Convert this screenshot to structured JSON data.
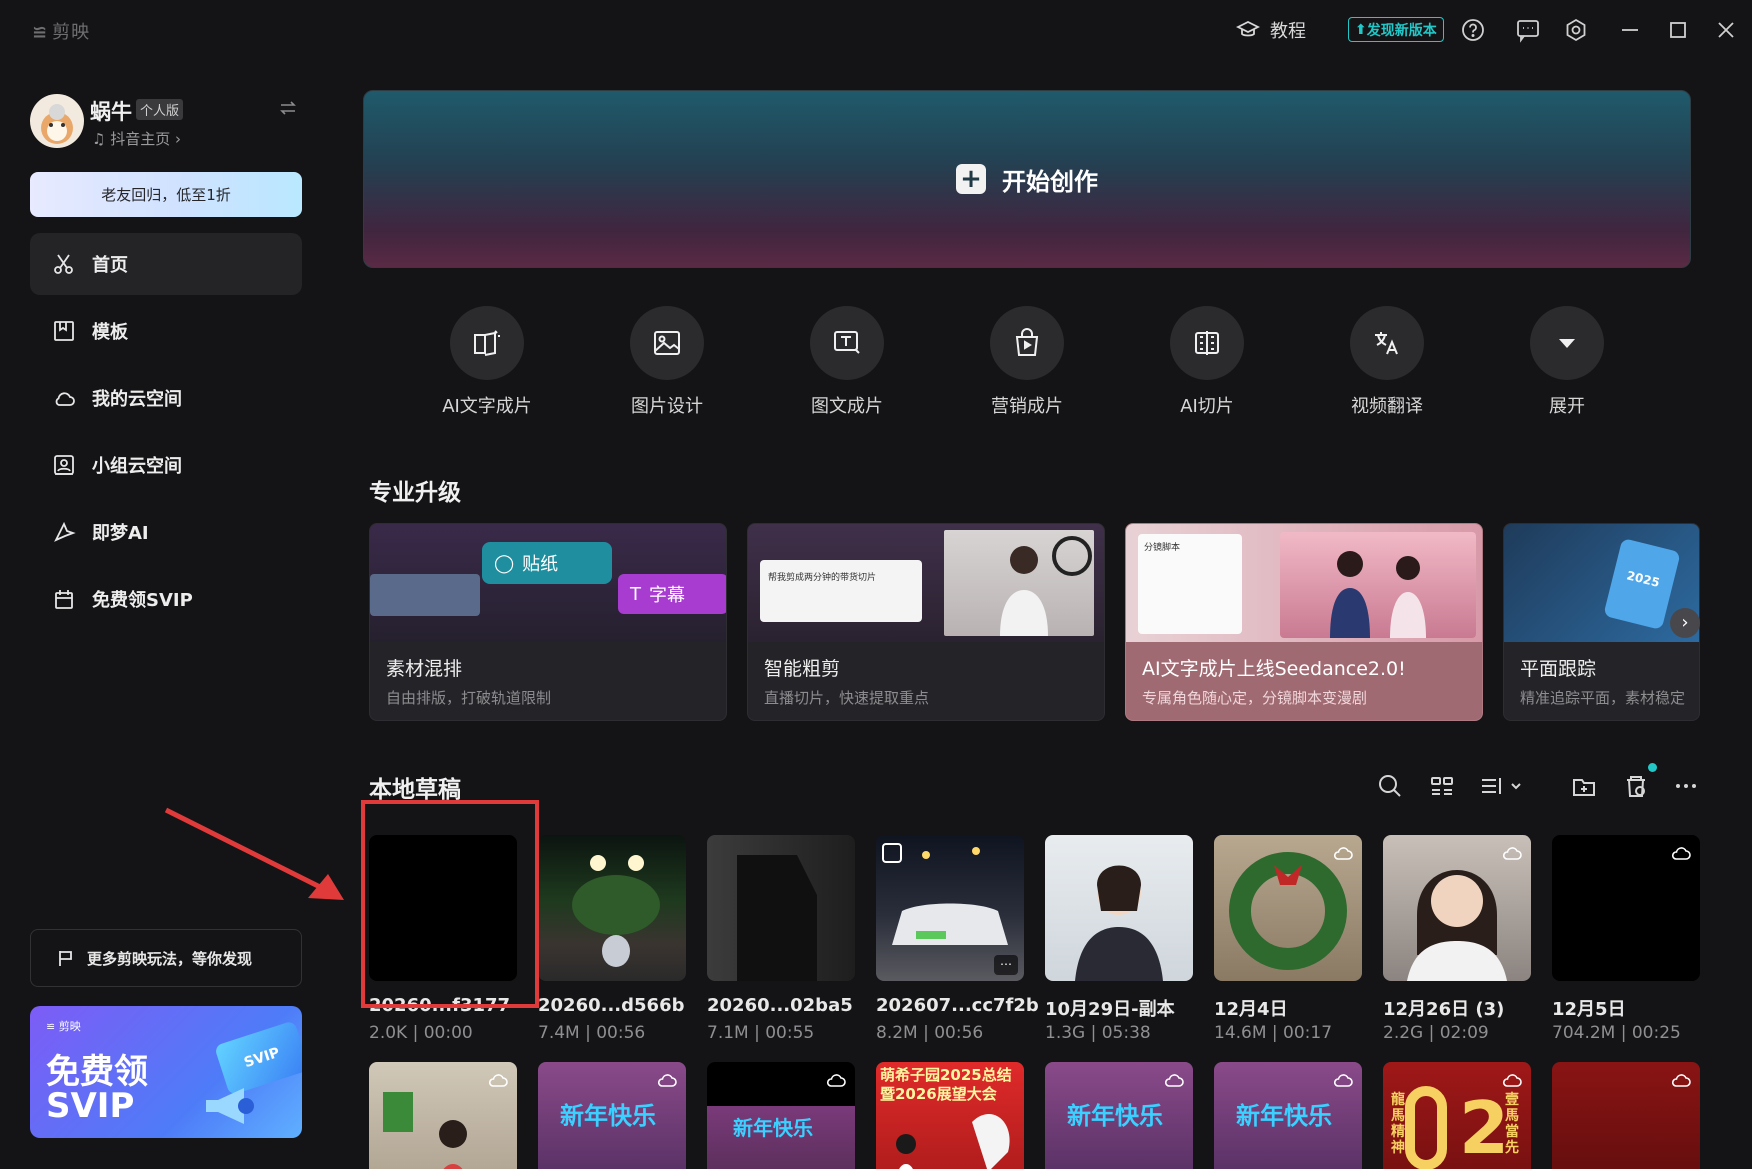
{
  "titlebar": {
    "app_name": "剪映",
    "tutorial_label": "教程",
    "update_label": "发现新版本",
    "icons": [
      "tutorial-icon",
      "help-icon",
      "message-icon",
      "settings-icon",
      "minimize-icon",
      "maximize-icon",
      "close-icon"
    ]
  },
  "profile": {
    "username": "蜗牛",
    "edition": "个人版",
    "douyin_link": "抖音主页",
    "promo_button": "老友回归，低至1折"
  },
  "nav": {
    "items": [
      {
        "label": "首页",
        "icon": "scissors-icon",
        "active": true
      },
      {
        "label": "模板",
        "icon": "template-icon",
        "active": false
      },
      {
        "label": "我的云空间",
        "icon": "cloud-icon",
        "active": false
      },
      {
        "label": "小组云空间",
        "icon": "group-space-icon",
        "active": false
      },
      {
        "label": "即梦AI",
        "icon": "dream-ai-icon",
        "active": false
      },
      {
        "label": "免费领SVIP",
        "icon": "gift-icon",
        "active": false
      }
    ]
  },
  "sidebar_bottom": {
    "more_label": "更多剪映玩法，等你发现",
    "svip_brand": "剪映",
    "svip_line1": "免费领",
    "svip_line2": "SVIP",
    "svip_ticket": "SVIP"
  },
  "hero": {
    "title": "开始创作"
  },
  "tools": [
    {
      "label": "AI文字成片",
      "icon": "ai-text-video-icon"
    },
    {
      "label": "图片设计",
      "icon": "image-design-icon"
    },
    {
      "label": "图文成片",
      "icon": "text-image-video-icon"
    },
    {
      "label": "营销成片",
      "icon": "marketing-bag-icon"
    },
    {
      "label": "AI切片",
      "icon": "ai-slice-icon"
    },
    {
      "label": "视频翻译",
      "icon": "translate-icon"
    },
    {
      "label": "展开",
      "icon": "expand-chevron-icon"
    }
  ],
  "upgrade": {
    "section_title": "专业升级",
    "cards": [
      {
        "title": "素材混排",
        "subtitle": "自由排版，打破轨道限制",
        "tags": [
          "贴纸",
          "字幕"
        ]
      },
      {
        "title": "智能粗剪",
        "subtitle": "直播切片，快速提取重点",
        "caption": "帮我剪成两分钟的带货切片"
      },
      {
        "title": "AI文字成片上线Seedance2.0!",
        "subtitle": "专属角色随心定，分镜脚本变漫剧",
        "caption": "分镜脚本"
      },
      {
        "title": "平面跟踪",
        "subtitle": "精准追踪平面，素材稳定",
        "badge": "2025"
      }
    ]
  },
  "drafts": {
    "section_title": "本地草稿",
    "items": [
      {
        "name": "20260...f3177",
        "meta": "2.0K | 00:00"
      },
      {
        "name": "20260...d566b",
        "meta": "7.4M | 00:56"
      },
      {
        "name": "20260...02ba5",
        "meta": "7.1M | 00:55"
      },
      {
        "name": "202607...cc7f2b",
        "meta": "8.2M | 00:56"
      },
      {
        "name": "10月29日-副本",
        "meta": "1.3G | 05:38"
      },
      {
        "name": "12月4日",
        "meta": "14.6M | 00:17"
      },
      {
        "name": "12月26日 (3)",
        "meta": "2.2G | 02:09"
      },
      {
        "name": "12月5日",
        "meta": "704.2M | 00:25"
      }
    ],
    "row2_texts": [
      "新年快乐",
      "新年快乐",
      "萌希子园2025总结暨2026展望大会",
      "新年快乐",
      "新年快乐",
      "龍馬精神",
      "壹馬當先"
    ]
  },
  "colors": {
    "background": "#141416",
    "accent": "#23c7c7",
    "highlight": "#e03a3a"
  }
}
